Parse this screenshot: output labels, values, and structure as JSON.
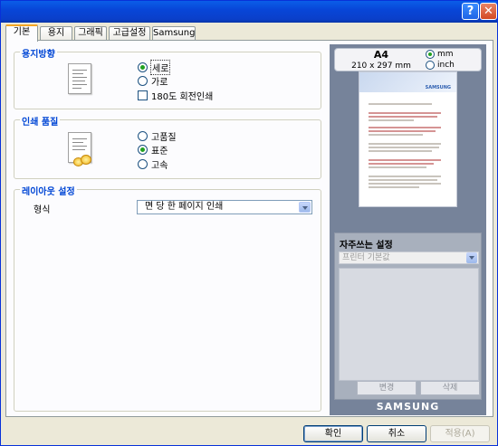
{
  "titlebar": {
    "help_icon": "?",
    "close_icon": "✕"
  },
  "tabs": [
    {
      "label": "기본",
      "active": true
    },
    {
      "label": "용지"
    },
    {
      "label": "그래픽"
    },
    {
      "label": "고급설정"
    },
    {
      "label": "Samsung"
    }
  ],
  "orientation": {
    "title": "용지방향",
    "options": [
      "세로",
      "가로"
    ],
    "selected": "세로",
    "rotate_label": "180도 회전인쇄"
  },
  "quality": {
    "title": "인쇄 품질",
    "options": [
      "고품질",
      "표준",
      "고속"
    ],
    "selected": "표준"
  },
  "layout": {
    "title": "레이아웃 설정",
    "type_label": "형식",
    "type_value": "면 당 한 페이지 인쇄"
  },
  "paper": {
    "size": "A4",
    "dimensions": "210 x 297 mm",
    "units": [
      "mm",
      "inch"
    ],
    "unit_selected": "mm"
  },
  "preview": {
    "logo": "SAMSUNG"
  },
  "favorites": {
    "title": "자주쓰는 설정",
    "select_value": "프린터 기본값",
    "change_label": "변경",
    "delete_label": "삭제"
  },
  "brand": "SAMSUNG",
  "buttons": {
    "ok": "확인",
    "cancel": "취소",
    "apply": "적용(A)"
  }
}
